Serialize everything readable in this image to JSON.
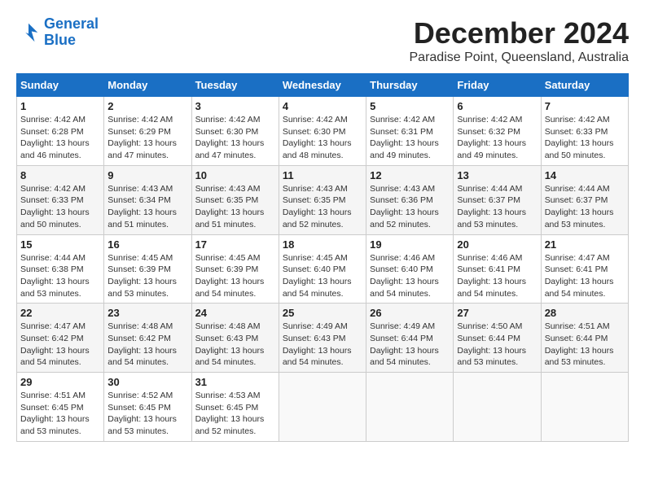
{
  "logo": {
    "line1": "General",
    "line2": "Blue"
  },
  "title": "December 2024",
  "location": "Paradise Point, Queensland, Australia",
  "weekdays": [
    "Sunday",
    "Monday",
    "Tuesday",
    "Wednesday",
    "Thursday",
    "Friday",
    "Saturday"
  ],
  "weeks": [
    [
      {
        "day": "1",
        "info": "Sunrise: 4:42 AM\nSunset: 6:28 PM\nDaylight: 13 hours\nand 46 minutes."
      },
      {
        "day": "2",
        "info": "Sunrise: 4:42 AM\nSunset: 6:29 PM\nDaylight: 13 hours\nand 47 minutes."
      },
      {
        "day": "3",
        "info": "Sunrise: 4:42 AM\nSunset: 6:30 PM\nDaylight: 13 hours\nand 47 minutes."
      },
      {
        "day": "4",
        "info": "Sunrise: 4:42 AM\nSunset: 6:30 PM\nDaylight: 13 hours\nand 48 minutes."
      },
      {
        "day": "5",
        "info": "Sunrise: 4:42 AM\nSunset: 6:31 PM\nDaylight: 13 hours\nand 49 minutes."
      },
      {
        "day": "6",
        "info": "Sunrise: 4:42 AM\nSunset: 6:32 PM\nDaylight: 13 hours\nand 49 minutes."
      },
      {
        "day": "7",
        "info": "Sunrise: 4:42 AM\nSunset: 6:33 PM\nDaylight: 13 hours\nand 50 minutes."
      }
    ],
    [
      {
        "day": "8",
        "info": "Sunrise: 4:42 AM\nSunset: 6:33 PM\nDaylight: 13 hours\nand 50 minutes."
      },
      {
        "day": "9",
        "info": "Sunrise: 4:43 AM\nSunset: 6:34 PM\nDaylight: 13 hours\nand 51 minutes."
      },
      {
        "day": "10",
        "info": "Sunrise: 4:43 AM\nSunset: 6:35 PM\nDaylight: 13 hours\nand 51 minutes."
      },
      {
        "day": "11",
        "info": "Sunrise: 4:43 AM\nSunset: 6:35 PM\nDaylight: 13 hours\nand 52 minutes."
      },
      {
        "day": "12",
        "info": "Sunrise: 4:43 AM\nSunset: 6:36 PM\nDaylight: 13 hours\nand 52 minutes."
      },
      {
        "day": "13",
        "info": "Sunrise: 4:44 AM\nSunset: 6:37 PM\nDaylight: 13 hours\nand 53 minutes."
      },
      {
        "day": "14",
        "info": "Sunrise: 4:44 AM\nSunset: 6:37 PM\nDaylight: 13 hours\nand 53 minutes."
      }
    ],
    [
      {
        "day": "15",
        "info": "Sunrise: 4:44 AM\nSunset: 6:38 PM\nDaylight: 13 hours\nand 53 minutes."
      },
      {
        "day": "16",
        "info": "Sunrise: 4:45 AM\nSunset: 6:39 PM\nDaylight: 13 hours\nand 53 minutes."
      },
      {
        "day": "17",
        "info": "Sunrise: 4:45 AM\nSunset: 6:39 PM\nDaylight: 13 hours\nand 54 minutes."
      },
      {
        "day": "18",
        "info": "Sunrise: 4:45 AM\nSunset: 6:40 PM\nDaylight: 13 hours\nand 54 minutes."
      },
      {
        "day": "19",
        "info": "Sunrise: 4:46 AM\nSunset: 6:40 PM\nDaylight: 13 hours\nand 54 minutes."
      },
      {
        "day": "20",
        "info": "Sunrise: 4:46 AM\nSunset: 6:41 PM\nDaylight: 13 hours\nand 54 minutes."
      },
      {
        "day": "21",
        "info": "Sunrise: 4:47 AM\nSunset: 6:41 PM\nDaylight: 13 hours\nand 54 minutes."
      }
    ],
    [
      {
        "day": "22",
        "info": "Sunrise: 4:47 AM\nSunset: 6:42 PM\nDaylight: 13 hours\nand 54 minutes."
      },
      {
        "day": "23",
        "info": "Sunrise: 4:48 AM\nSunset: 6:42 PM\nDaylight: 13 hours\nand 54 minutes."
      },
      {
        "day": "24",
        "info": "Sunrise: 4:48 AM\nSunset: 6:43 PM\nDaylight: 13 hours\nand 54 minutes."
      },
      {
        "day": "25",
        "info": "Sunrise: 4:49 AM\nSunset: 6:43 PM\nDaylight: 13 hours\nand 54 minutes."
      },
      {
        "day": "26",
        "info": "Sunrise: 4:49 AM\nSunset: 6:44 PM\nDaylight: 13 hours\nand 54 minutes."
      },
      {
        "day": "27",
        "info": "Sunrise: 4:50 AM\nSunset: 6:44 PM\nDaylight: 13 hours\nand 53 minutes."
      },
      {
        "day": "28",
        "info": "Sunrise: 4:51 AM\nSunset: 6:44 PM\nDaylight: 13 hours\nand 53 minutes."
      }
    ],
    [
      {
        "day": "29",
        "info": "Sunrise: 4:51 AM\nSunset: 6:45 PM\nDaylight: 13 hours\nand 53 minutes."
      },
      {
        "day": "30",
        "info": "Sunrise: 4:52 AM\nSunset: 6:45 PM\nDaylight: 13 hours\nand 53 minutes."
      },
      {
        "day": "31",
        "info": "Sunrise: 4:53 AM\nSunset: 6:45 PM\nDaylight: 13 hours\nand 52 minutes."
      },
      {
        "day": "",
        "info": ""
      },
      {
        "day": "",
        "info": ""
      },
      {
        "day": "",
        "info": ""
      },
      {
        "day": "",
        "info": ""
      }
    ]
  ]
}
